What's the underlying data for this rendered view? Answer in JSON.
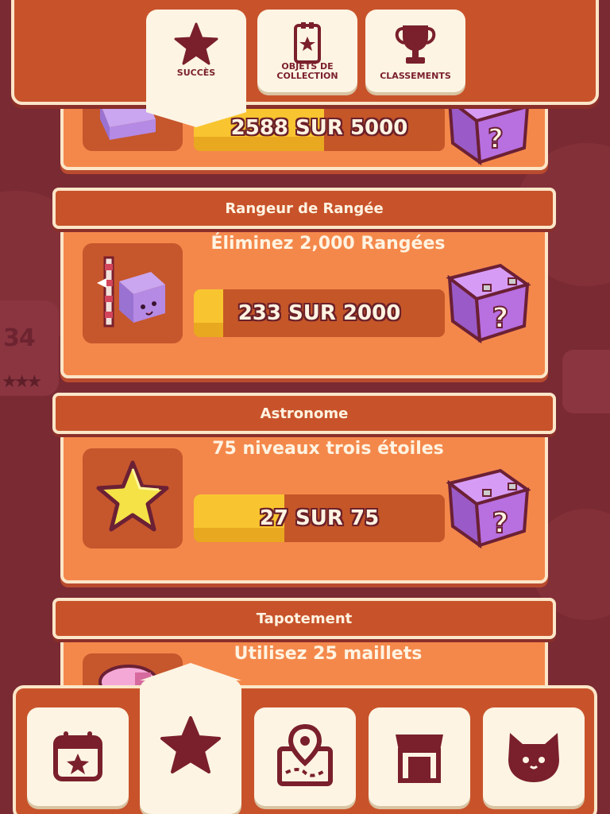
{
  "header": {
    "tabs": [
      {
        "label": "SUCCÈS",
        "icon": "star-icon",
        "active": true
      },
      {
        "label": "OBJETS DE COLLECTION",
        "icon": "collection-card-icon",
        "active": false
      },
      {
        "label": "CLASSEMENTS",
        "icon": "trophy-icon",
        "active": false
      }
    ]
  },
  "side": {
    "level_number": "34",
    "stars": "★★★"
  },
  "achievements": [
    {
      "title": "",
      "description": "",
      "progress_text": "2588 SUR 5000",
      "current": 2588,
      "goal": 5000,
      "icon": "cube-character-icon",
      "reward": "mystery-box-icon"
    },
    {
      "title": "Rangeur de Rangée",
      "description": "Éliminez 2,000 Rangées",
      "progress_text": "233 SUR 2000",
      "current": 233,
      "goal": 2000,
      "icon": "cube-row-clear-icon",
      "reward": "mystery-box-icon"
    },
    {
      "title": "Astronome",
      "description": "75 niveaux trois étoiles",
      "progress_text": "27 SUR 75",
      "current": 27,
      "goal": 75,
      "icon": "yellow-star-icon",
      "reward": "mystery-box-icon"
    },
    {
      "title": "Tapotement",
      "description": "Utilisez 25 maillets",
      "progress_text": "",
      "current": null,
      "goal": 25,
      "icon": "mallet-icon",
      "reward": "mystery-box-icon"
    }
  ],
  "bottom_nav": [
    {
      "icon": "calendar-star-icon",
      "active": false
    },
    {
      "icon": "star-icon",
      "active": true
    },
    {
      "icon": "map-pin-icon",
      "active": false
    },
    {
      "icon": "shop-icon",
      "active": false
    },
    {
      "icon": "cat-face-icon",
      "active": false
    }
  ],
  "colors": {
    "background": "#7a2a33",
    "panel": "#f4884b",
    "ribbon": "#c8532b",
    "bar_fill": "#f8c530",
    "box_purple": "#b267d6",
    "text_cream": "#fff3e1",
    "icon_maroon": "#7a1f2c"
  }
}
